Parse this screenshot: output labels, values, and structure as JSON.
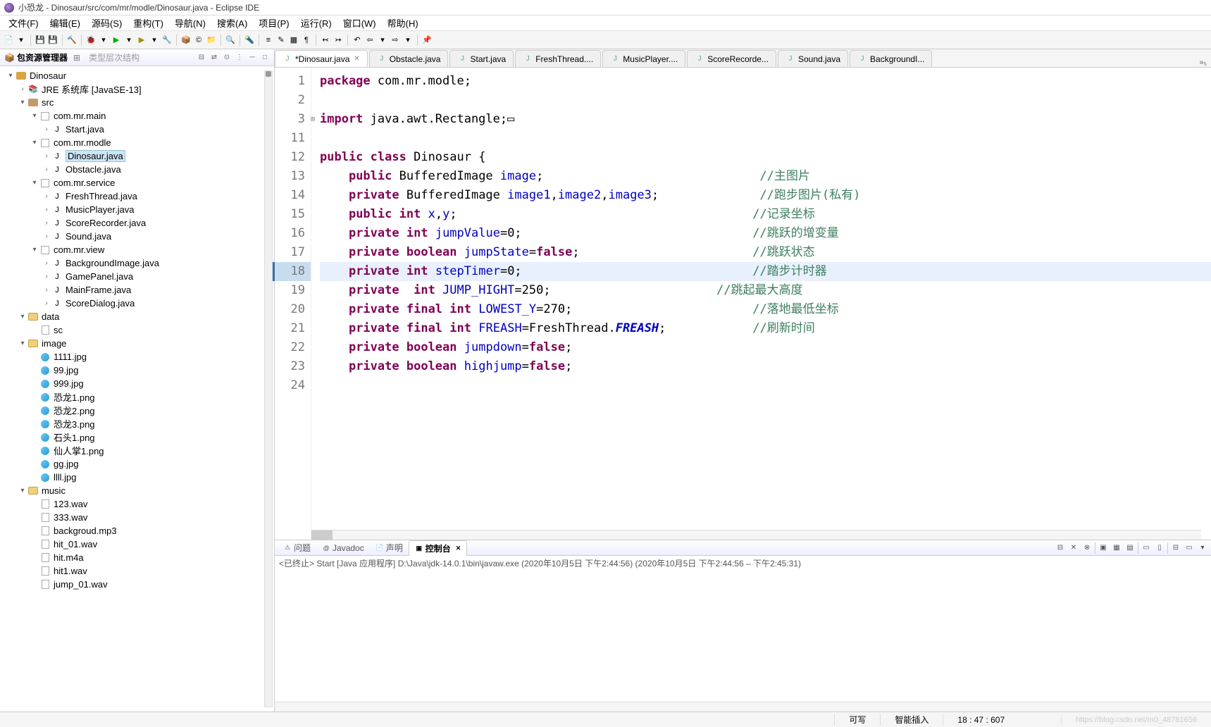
{
  "title": "小恐龙 - Dinosaur/src/com/mr/modle/Dinosaur.java - Eclipse IDE",
  "menu": [
    "文件(F)",
    "编辑(E)",
    "源码(S)",
    "重构(T)",
    "导航(N)",
    "搜索(A)",
    "项目(P)",
    "运行(R)",
    "窗口(W)",
    "帮助(H)"
  ],
  "sidebar": {
    "view_title": "包资源管理器",
    "secondary_view": "类型层次结构",
    "project": "Dinosaur",
    "jre": "JRE 系统库 [JavaSE-13]",
    "src": "src",
    "packages": {
      "main": {
        "name": "com.mr.main",
        "files": [
          "Start.java"
        ]
      },
      "modle": {
        "name": "com.mr.modle",
        "files": [
          "Dinosaur.java",
          "Obstacle.java"
        ]
      },
      "service": {
        "name": "com.mr.service",
        "files": [
          "FreshThread.java",
          "MusicPlayer.java",
          "ScoreRecorder.java",
          "Sound.java"
        ]
      },
      "view": {
        "name": "com.mr.view",
        "files": [
          "BackgroundImage.java",
          "GamePanel.java",
          "MainFrame.java",
          "ScoreDialog.java"
        ]
      }
    },
    "data_folder": {
      "name": "data",
      "files": [
        "sc"
      ]
    },
    "image_folder": {
      "name": "image",
      "files": [
        "1111.jpg",
        "99.jpg",
        "999.jpg",
        "恐龙1.png",
        "恐龙2.png",
        "恐龙3.png",
        "石头1.png",
        "仙人掌1.png",
        "gg.jpg",
        "llll.jpg"
      ]
    },
    "music_folder": {
      "name": "music",
      "files": [
        "123.wav",
        "333.wav",
        "backgroud.mp3",
        "hit_01.wav",
        "hit.m4a",
        "hit1.wav",
        "jump_01.wav"
      ]
    }
  },
  "editor_tabs": [
    {
      "label": "*Dinosaur.java",
      "active": true,
      "dirty": true
    },
    {
      "label": "Obstacle.java"
    },
    {
      "label": "Start.java"
    },
    {
      "label": "FreshThread...."
    },
    {
      "label": "MusicPlayer...."
    },
    {
      "label": "ScoreRecorde..."
    },
    {
      "label": "Sound.java"
    },
    {
      "label": "BackgroundI..."
    }
  ],
  "tabs_overflow": "»₅",
  "code": {
    "lines": [
      {
        "n": "1",
        "html": "<span class='kw'>package</span> com.mr.modle;"
      },
      {
        "n": "2",
        "html": ""
      },
      {
        "n": "3",
        "folded": true,
        "html": "<span class='kw'>import</span> java.awt.Rectangle;▭"
      },
      {
        "n": "11",
        "html": ""
      },
      {
        "n": "12",
        "html": "<span class='kw'>public</span> <span class='kw'>class</span> Dinosaur {"
      },
      {
        "n": "13",
        "html": "    <span class='kw'>public</span> BufferedImage <span class='fld'>image</span>;                              <span class='cmt'>//主图片</span>"
      },
      {
        "n": "14",
        "html": "    <span class='kw'>private</span> BufferedImage <span class='fld'>image1</span>,<span class='fld'>image2</span>,<span class='fld'>image3</span>;              <span class='cmt'>//跑步图片(私有)</span>"
      },
      {
        "n": "15",
        "html": "    <span class='kw'>public</span> <span class='kw'>int</span> <span class='fld'>x</span>,<span class='fld'>y</span>;                                         <span class='cmt'>//记录坐标</span>"
      },
      {
        "n": "16",
        "html": "    <span class='kw'>private</span> <span class='kw'>int</span> <span class='fld'>jumpValue</span>=0;                                <span class='cmt'>//跳跃的增变量</span>"
      },
      {
        "n": "17",
        "html": "    <span class='kw'>private</span> <span class='kw'>boolean</span> <span class='fld'>jumpState</span>=<span class='kw'>false</span>;                        <span class='cmt'>//跳跃状态</span>"
      },
      {
        "n": "18",
        "hl": true,
        "html": "    <span class='kw'>private</span> <span class='kw'>int</span> <span class='fld'>stepTimer</span>=0;                                <span class='cmt'>//踏步计时器</span>"
      },
      {
        "n": "19",
        "html": "    <span class='kw'>private</span>  <span class='kw'>int</span> <span class='fld'>JUMP_HIGHT</span>=250;                       <span class='cmt'>//跳起最大高度</span>"
      },
      {
        "n": "20",
        "html": "    <span class='kw'>private</span> <span class='kw'>final</span> <span class='kw'>int</span> <span class='fld'>LOWEST_Y</span>=270;                         <span class='cmt'>//落地最低坐标</span>"
      },
      {
        "n": "21",
        "html": "    <span class='kw'>private</span> <span class='kw'>final</span> <span class='kw'>int</span> <span class='fld'>FREASH</span>=FreshThread.<span class='sfld'>FREASH</span>;            <span class='cmt'>//刷新时间</span>"
      },
      {
        "n": "22",
        "html": "    <span class='kw'>private</span> <span class='kw'>boolean</span> <span class='fld'>jumpdown</span>=<span class='kw'>false</span>;"
      },
      {
        "n": "23",
        "html": "    <span class='kw'>private</span> <span class='kw'>boolean</span> <span class='fld'>highjump</span>=<span class='kw'>false</span>;"
      },
      {
        "n": "24",
        "html": ""
      }
    ]
  },
  "bottom_tabs": [
    {
      "label": "问题",
      "icon": "⚠"
    },
    {
      "label": "Javadoc",
      "icon": "@"
    },
    {
      "label": "声明",
      "icon": "📄"
    },
    {
      "label": "控制台",
      "icon": "▣",
      "active": true
    }
  ],
  "console_line": "<已终止> Start [Java 应用程序] D:\\Java\\jdk-14.0.1\\bin\\javaw.exe  (2020年10月5日 下午2:44:56)    (2020年10月5日 下午2:44:56 – 下午2:45:31)",
  "status": {
    "writable": "可写",
    "insert": "智能插入",
    "cursor": "18 : 47 : 607"
  }
}
